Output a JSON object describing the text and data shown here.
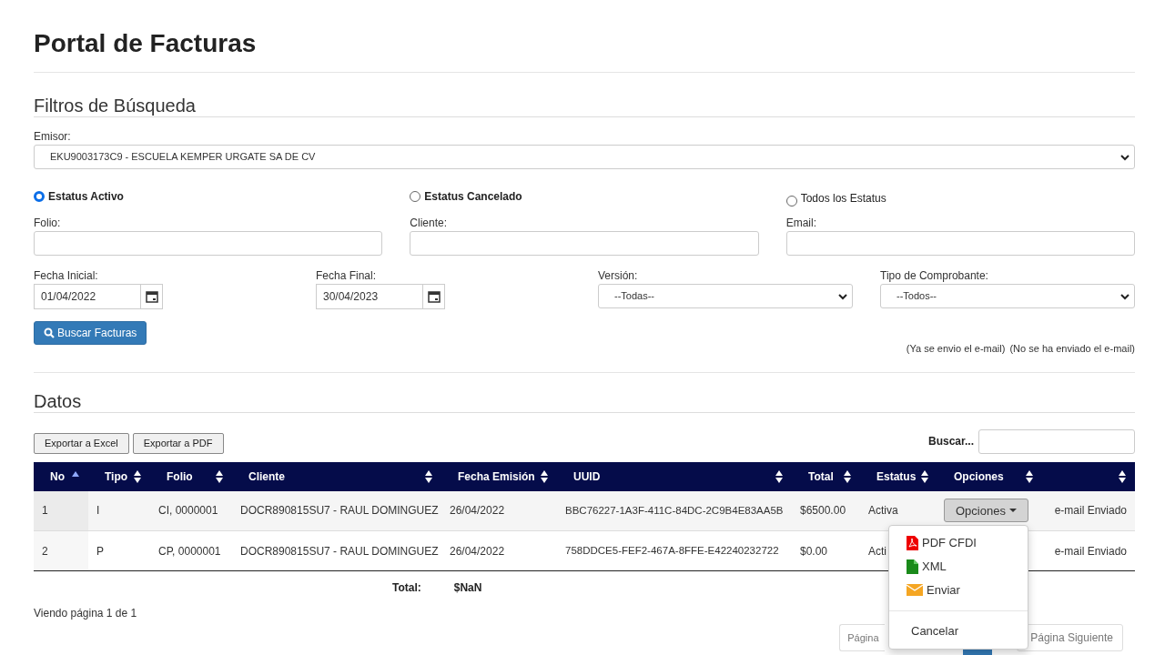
{
  "title": "Portal de Facturas",
  "filters": {
    "heading": "Filtros de Búsqueda",
    "emisor": {
      "label": "Emisor:",
      "value": "EKU9003173C9 - ESCUELA KEMPER URGATE SA DE CV"
    },
    "status_options": [
      {
        "label": "Estatus Activo",
        "selected": true
      },
      {
        "label": "Estatus Cancelado",
        "selected": false
      },
      {
        "label": "Todos los Estatus",
        "selected": false
      }
    ],
    "text_fields": [
      {
        "label": "Folio:"
      },
      {
        "label": "Cliente:"
      },
      {
        "label": "Email:"
      }
    ],
    "date_fields": [
      {
        "label": "Fecha Inicial:",
        "value": "01/04/2022"
      },
      {
        "label": "Fecha Final:",
        "value": "30/04/2023"
      }
    ],
    "selects": [
      {
        "label": "Versión:",
        "value": "--Todas--"
      },
      {
        "label": "Tipo de Comprobante:",
        "value": "--Todos--"
      }
    ],
    "search_button": "Buscar Facturas",
    "legend": [
      "(Ya se envio el e-mail)",
      "(No se ha enviado el e-mail)"
    ]
  },
  "data": {
    "heading": "Datos",
    "export_buttons": [
      "Exportar a Excel",
      "Exportar a PDF"
    ],
    "search_label": "Buscar...",
    "columns": [
      {
        "label": "No",
        "sorted": true
      },
      {
        "label": "Tipo",
        "sorted": false
      },
      {
        "label": "Folio",
        "sorted": false
      },
      {
        "label": "Cliente",
        "sorted": false
      },
      {
        "label": "Fecha Emisión",
        "sorted": false
      },
      {
        "label": "UUID",
        "sorted": false
      },
      {
        "label": "Total",
        "sorted": false
      },
      {
        "label": "Estatus",
        "sorted": false
      },
      {
        "label": "Opciones",
        "sorted": false
      },
      {
        "sorted": false
      }
    ],
    "rows": [
      {
        "no": "1",
        "tipo": "I",
        "folio": "CI, 0000001",
        "cliente": "DOCR890815SU7 - RAUL DOMINGUEZ",
        "fecha": "26/04/2022",
        "uuid": "BBC76227-1A3F-411C-84DC-2C9B4E83AA5B",
        "total": "$6500.00",
        "estatus": "Activa",
        "options_button": "Opciones",
        "email": "e-mail Enviado"
      },
      {
        "no": "2",
        "tipo": "P",
        "folio": "CP, 0000001",
        "cliente": "DOCR890815SU7 - RAUL DOMINGUEZ",
        "fecha": "26/04/2022",
        "uuid": "758DDCE5-FEF2-467A-8FFE-E42240232722",
        "total": "$0.00",
        "estatus": "Acti",
        "email": "e-mail Enviado"
      }
    ],
    "total_label": "Total:",
    "total_value": "$NaN",
    "page_info": "Viendo página 1 de 1",
    "pagination": {
      "previous": "Página",
      "next": "Página Siguiente"
    },
    "menu": [
      {
        "kind": "pdf",
        "label": "PDF CFDI"
      },
      {
        "kind": "xml",
        "label": "XML"
      },
      {
        "kind": "mail",
        "label": "Enviar"
      },
      {
        "kind": "divider"
      },
      {
        "kind": "plain",
        "label": "Cancelar"
      }
    ]
  }
}
